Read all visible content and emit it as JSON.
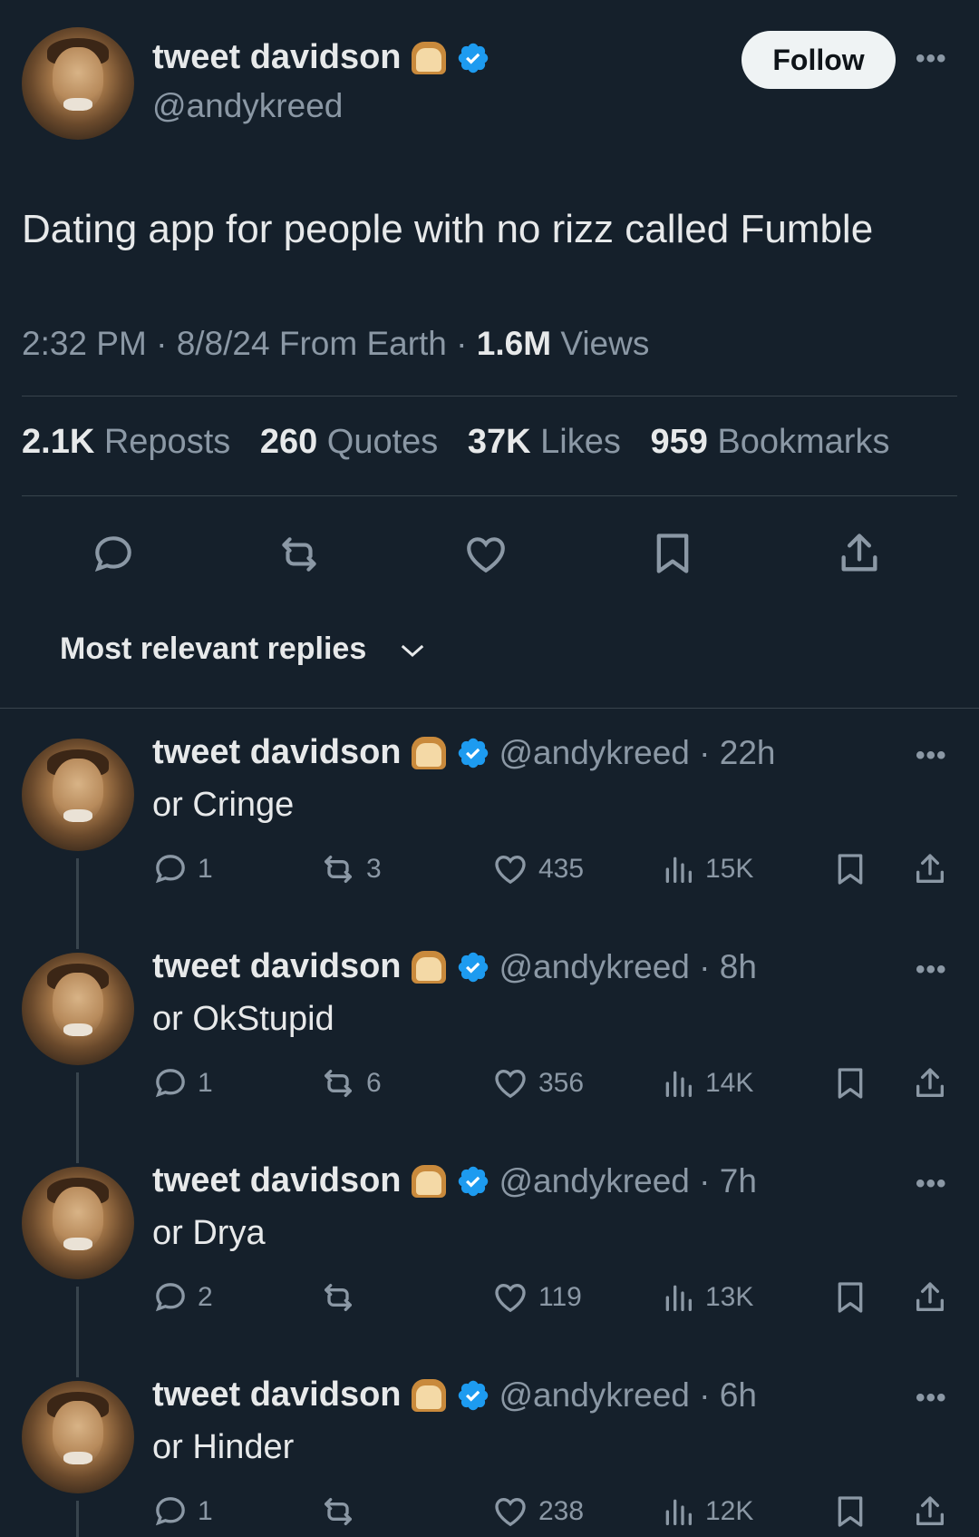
{
  "tweet": {
    "author_name": "tweet davidson",
    "author_handle": "@andykreed",
    "follow_label": "Follow",
    "more_label": "•••",
    "text": "Dating app for people with no rizz called Fumble",
    "time": "2:32 PM",
    "date": "8/8/24",
    "source": "From Earth",
    "views_count": "1.6M",
    "views_label": "Views",
    "sep": "·",
    "stats": {
      "reposts_count": "2.1K",
      "reposts_label": "Reposts",
      "quotes_count": "260",
      "quotes_label": "Quotes",
      "likes_count": "37K",
      "likes_label": "Likes",
      "bookmarks_count": "959",
      "bookmarks_label": "Bookmarks"
    }
  },
  "sort_label": "Most relevant replies",
  "colors": {
    "background": "#15202b",
    "verified": "#1d9bf0",
    "muted": "#8b98a5",
    "text": "#e7e9ea"
  },
  "replies": [
    {
      "name": "tweet davidson",
      "handle": "@andykreed",
      "time": "22h",
      "text": "or Cringe",
      "replies": "1",
      "reposts": "3",
      "likes": "435",
      "views": "15K"
    },
    {
      "name": "tweet davidson",
      "handle": "@andykreed",
      "time": "8h",
      "text": "or OkStupid",
      "replies": "1",
      "reposts": "6",
      "likes": "356",
      "views": "14K"
    },
    {
      "name": "tweet davidson",
      "handle": "@andykreed",
      "time": "7h",
      "text": "or Drya",
      "replies": "2",
      "reposts": "",
      "likes": "119",
      "views": "13K"
    },
    {
      "name": "tweet davidson",
      "handle": "@andykreed",
      "time": "6h",
      "text": "or Hinder",
      "replies": "1",
      "reposts": "",
      "likes": "238",
      "views": "12K"
    }
  ]
}
